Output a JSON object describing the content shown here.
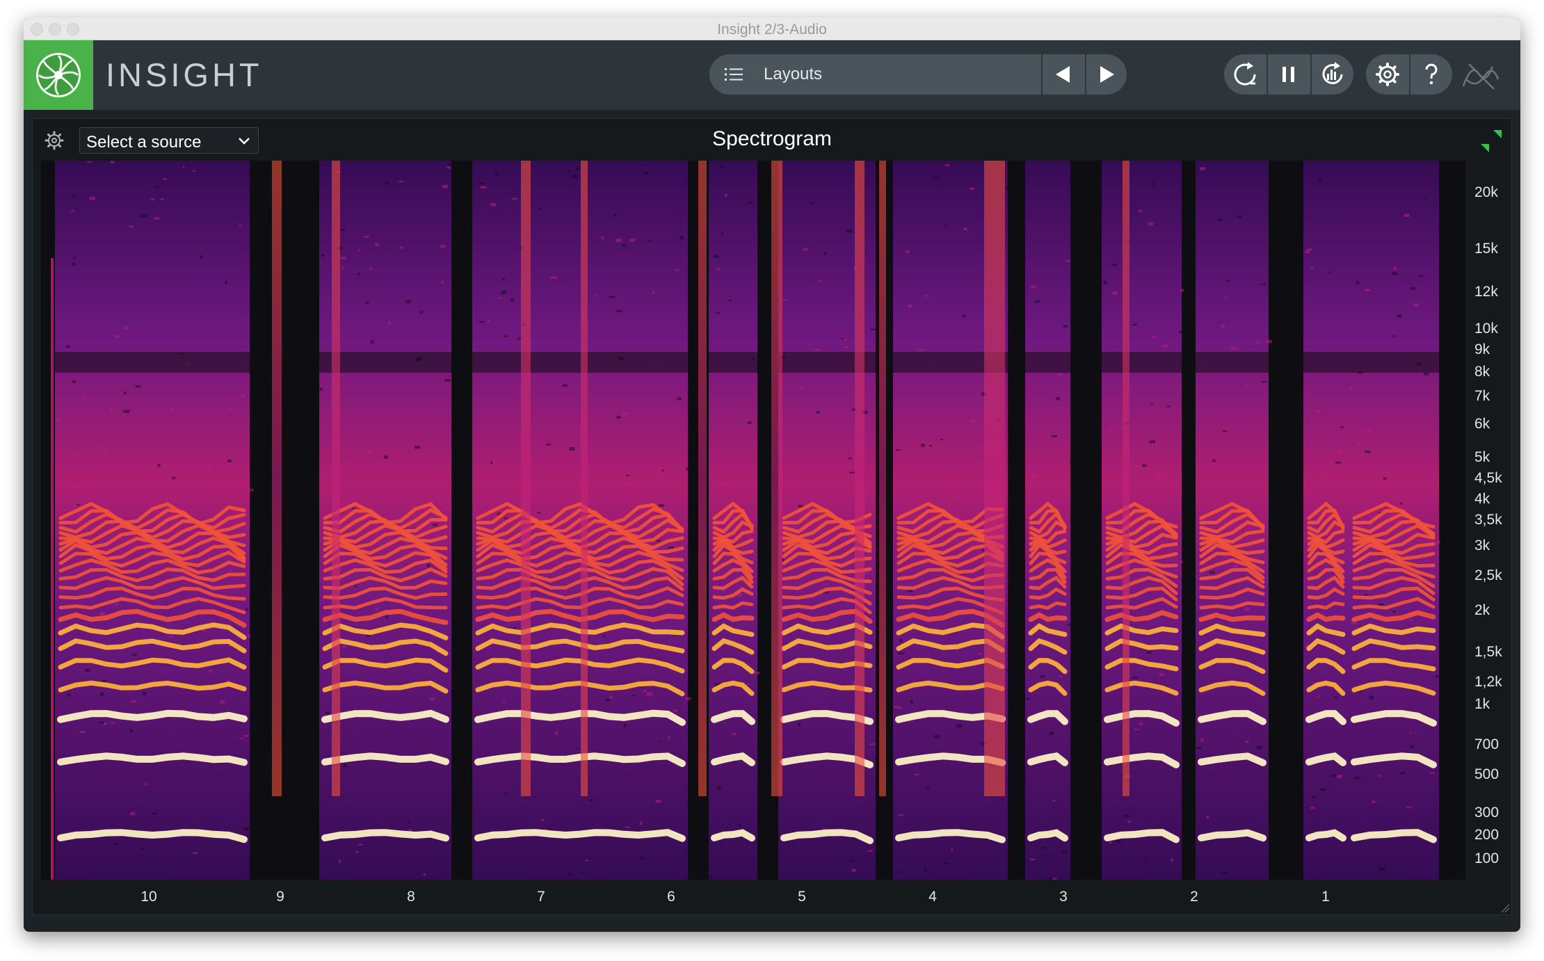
{
  "window": {
    "title": "Insight 2/3-Audio"
  },
  "app": {
    "name": "INSIGHT",
    "accent": "#49b248"
  },
  "toolbar": {
    "layouts_label": "Layouts"
  },
  "panel": {
    "title": "Spectrogram",
    "source_placeholder": "Select a source"
  },
  "freq_axis": [
    "20k",
    "15k",
    "12k",
    "10k",
    "9k",
    "8k",
    "7k",
    "6k",
    "5k",
    "4,5k",
    "4k",
    "3,5k",
    "3k",
    "2,5k",
    "2k",
    "1,5k",
    "1,2k",
    "1k",
    "700",
    "500",
    "300",
    "200",
    "100"
  ],
  "time_axis": [
    "10",
    "9",
    "8",
    "7",
    "6",
    "5",
    "4",
    "3",
    "2",
    "1"
  ],
  "spectrogram": {
    "colormap": [
      "#0e0d12",
      "#3a0b5c",
      "#7a1a8c",
      "#c2207a",
      "#f0513a",
      "#ffb23a",
      "#fff7c8"
    ]
  }
}
